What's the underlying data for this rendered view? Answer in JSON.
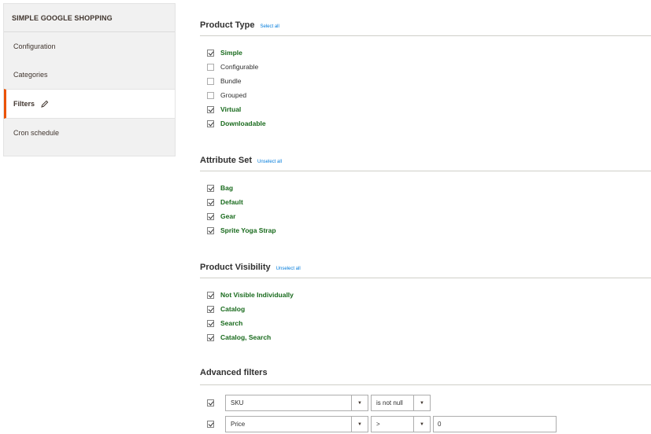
{
  "sidebar": {
    "title": "SIMPLE GOOGLE SHOPPING",
    "items": [
      {
        "label": "Configuration",
        "active": false
      },
      {
        "label": "Categories",
        "active": false
      },
      {
        "label": "Filters",
        "active": true
      },
      {
        "label": "Cron schedule",
        "active": false
      }
    ]
  },
  "product_type": {
    "title": "Product Type",
    "link": "Select all",
    "options": [
      {
        "label": "Simple",
        "checked": true
      },
      {
        "label": "Configurable",
        "checked": false
      },
      {
        "label": "Bundle",
        "checked": false
      },
      {
        "label": "Grouped",
        "checked": false
      },
      {
        "label": "Virtual",
        "checked": true
      },
      {
        "label": "Downloadable",
        "checked": true
      }
    ]
  },
  "attribute_set": {
    "title": "Attribute Set",
    "link": "Unselect all",
    "options": [
      {
        "label": "Bag",
        "checked": true
      },
      {
        "label": "Default",
        "checked": true
      },
      {
        "label": "Gear",
        "checked": true
      },
      {
        "label": "Sprite Yoga Strap",
        "checked": true
      }
    ]
  },
  "product_visibility": {
    "title": "Product Visibility",
    "link": "Unselect all",
    "options": [
      {
        "label": "Not Visible Individually",
        "checked": true
      },
      {
        "label": "Catalog",
        "checked": true
      },
      {
        "label": "Search",
        "checked": true
      },
      {
        "label": "Catalog, Search",
        "checked": true
      }
    ]
  },
  "advanced_filters": {
    "title": "Advanced filters",
    "rows": [
      {
        "checked": true,
        "attribute": "SKU",
        "condition": "is not null",
        "value": null
      },
      {
        "checked": true,
        "attribute": "Price",
        "condition": ">",
        "value": "0"
      }
    ]
  },
  "colors": {
    "accent": "#eb5202",
    "checked_label": "#186a1c",
    "link": "#007bdb"
  }
}
